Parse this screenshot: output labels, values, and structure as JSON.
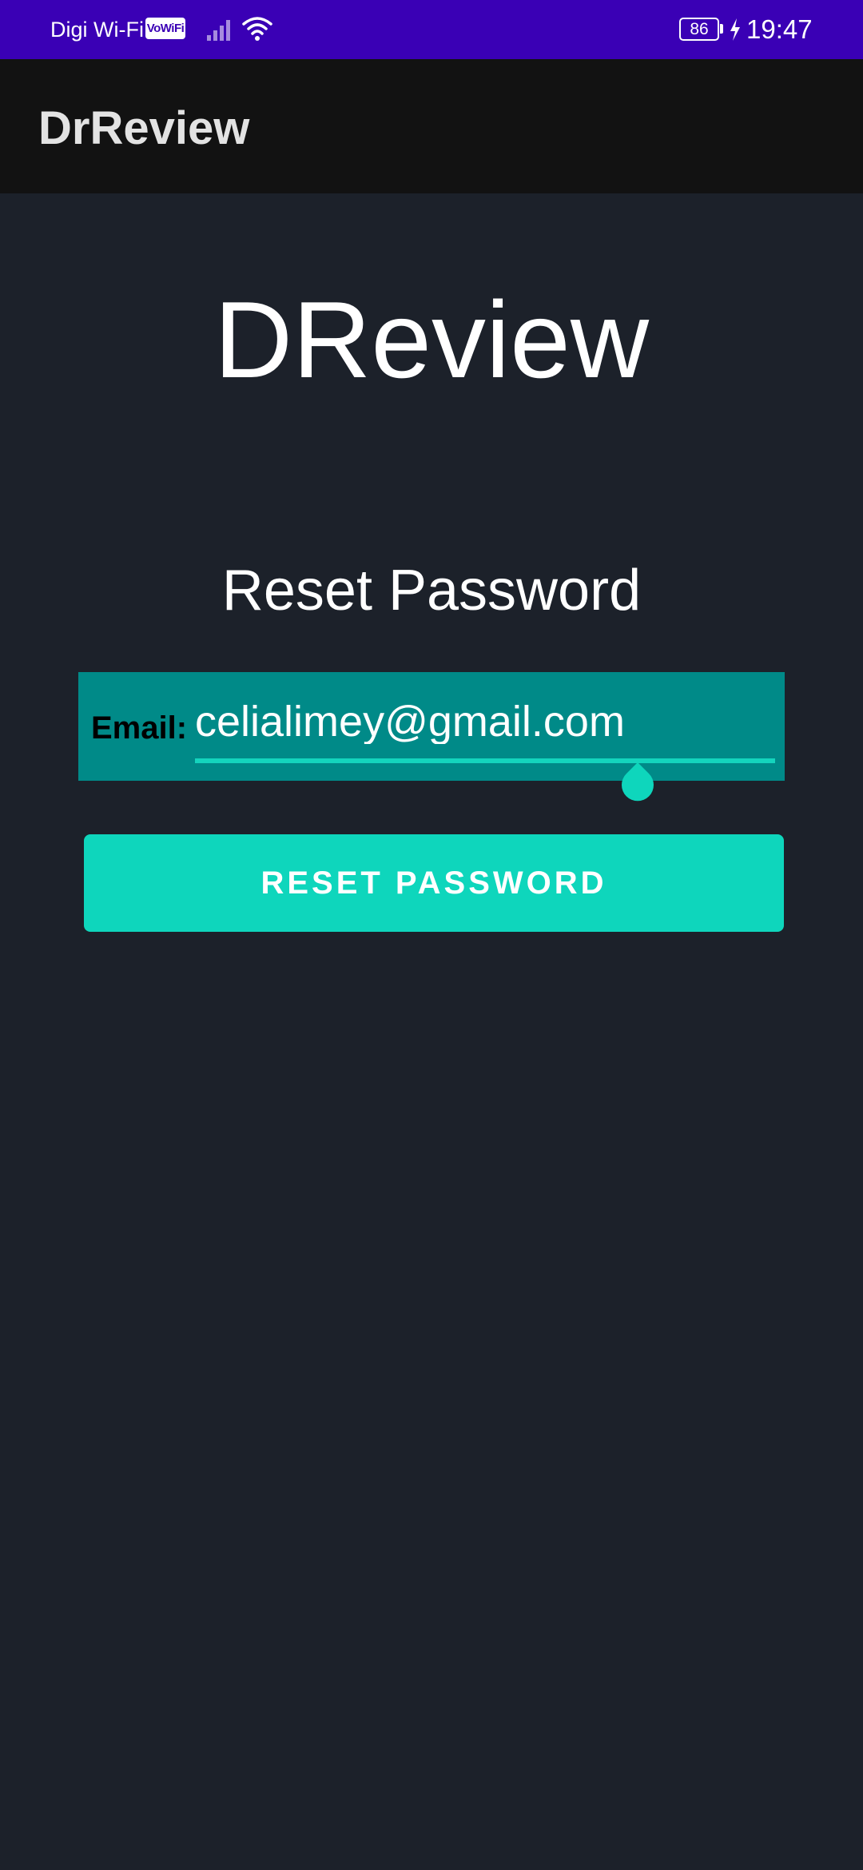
{
  "status_bar": {
    "carrier": "Digi Wi-Fi",
    "vowifi_badge": "VoWiFi",
    "battery_level": "86",
    "time": "19:47",
    "icons": [
      "signal-icon",
      "wifi-icon",
      "battery-icon",
      "charging-bolt-icon"
    ]
  },
  "toolbar": {
    "title": "DrReview"
  },
  "main": {
    "logo_text": "DReview",
    "section_title": "Reset Password",
    "email": {
      "label": "Email:",
      "value": "celialimey@gmail.com"
    },
    "reset_button_label": "RESET PASSWORD"
  },
  "colors": {
    "status_bar": "#3a00b5",
    "toolbar": "#121212",
    "background": "#1c212a",
    "email_row": "#008a88",
    "accent": "#0ed6bc"
  }
}
